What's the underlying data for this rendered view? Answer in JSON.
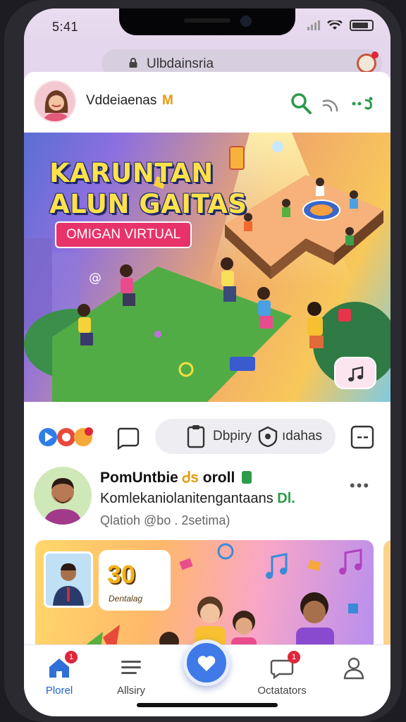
{
  "status_bar": {
    "time": "5:41"
  },
  "browser": {
    "url": "Ulbdainsria"
  },
  "header": {
    "host_name": "Vddeiaenas",
    "host_badge": "M"
  },
  "banner": {
    "title_line1": "KARUNTAN",
    "title_line2": "ALUN GAITAS",
    "subtitle": "OMIGAN VIRTUAL"
  },
  "action_row": {
    "pill_left": "Dbpiry",
    "pill_right": "ıdahas"
  },
  "post": {
    "title": "PomUntbie",
    "title_emoji": "Ꮷs",
    "title_suffix": "oroll",
    "subtitle": "Komlekaniolanitengantaans",
    "subtitle_highlight": "Dl.",
    "meta": "Qlatioh @bo . 2setima)",
    "thumb_number": "30",
    "thumb_caption": "Dentalag"
  },
  "tabbar": {
    "tabs": [
      {
        "label": "Plorel",
        "active": true,
        "badge": "1"
      },
      {
        "label": "Allsiry",
        "active": false
      },
      {
        "label": "Octatators",
        "active": false,
        "badge": "1"
      }
    ]
  },
  "colors": {
    "accent": "#3f7ae8",
    "badge": "#e0263a",
    "banner_title": "#ffe24a",
    "banner_pill": "#e8336a"
  }
}
